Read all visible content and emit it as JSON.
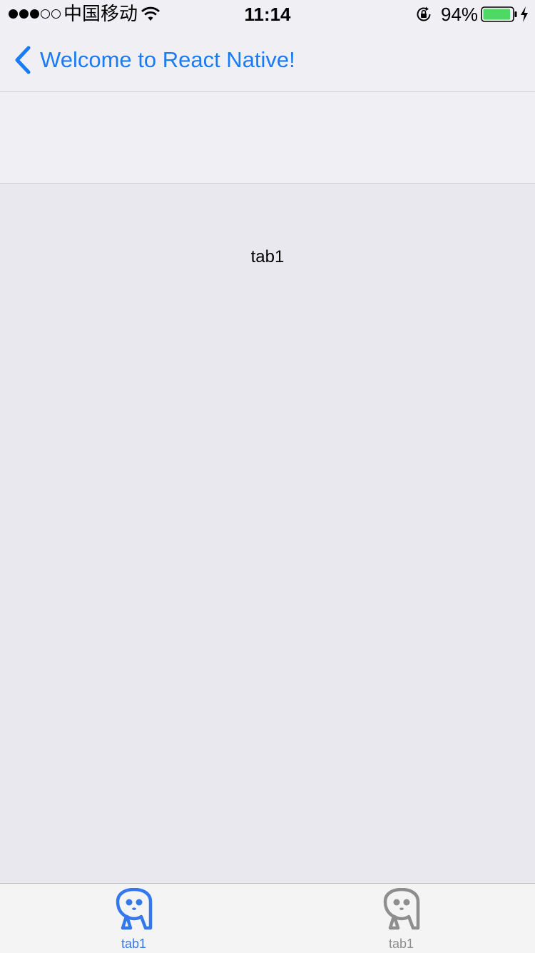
{
  "status_bar": {
    "carrier": "中国移动",
    "time": "11:14",
    "battery_percent": "94%",
    "battery_level": 0.94,
    "signal_bars": 3,
    "signal_total": 5,
    "icons": [
      "wifi-icon",
      "rotation-lock-icon",
      "battery-icon",
      "charging-bolt-icon"
    ]
  },
  "nav": {
    "back_label": "Welcome to React Native!",
    "back_icon": "chevron-left-icon"
  },
  "content": {
    "text": "tab1"
  },
  "tab_bar": {
    "tabs": [
      {
        "label": "tab1",
        "icon": "tab-mascot-icon",
        "selected": true
      },
      {
        "label": "tab1",
        "icon": "tab-mascot-icon",
        "selected": false
      }
    ]
  },
  "colors": {
    "accent": "#1a7cf5",
    "tab_active": "#3478f0",
    "tab_inactive": "#8e8e8e",
    "bar_background": "#efeff4",
    "content_background": "#e9e8ee",
    "battery_fill": "#4cd964"
  }
}
